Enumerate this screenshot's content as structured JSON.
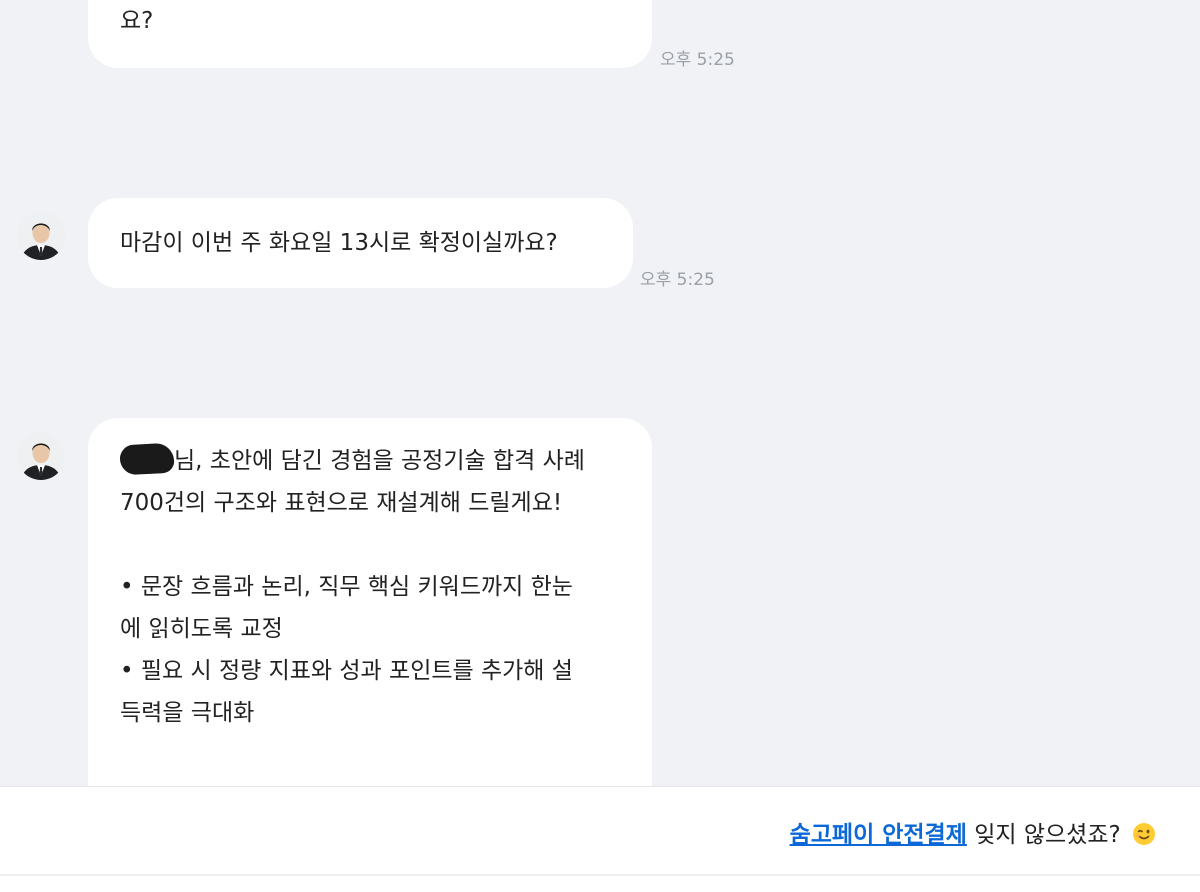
{
  "messages": [
    {
      "lines": [
        "요?"
      ],
      "time": "오후 5:25"
    },
    {
      "lines": [
        "마감이 이번 주 화요일 13시로 확정이실까요?"
      ],
      "time": "오후 5:25"
    },
    {
      "first_line_suffix": "님, 초안에 담긴 경험을 공정기술 합격 사례",
      "lines": [
        "700건의 구조와 표현으로 재설계해 드릴게요!",
        "",
        "• 문장 흐름과 논리, 직무 핵심 키워드까지 한눈",
        "에 읽히도록 교정",
        "• 필요 시 정량 지표와 성과 포인트를 추가해 설",
        "득력을 극대화"
      ]
    }
  ],
  "footer": {
    "link_text": "숨고페이 안전결제",
    "rest_text": " 잊지 않으셨죠? ",
    "emoji_icon": "wink-emoji-icon"
  },
  "colors": {
    "background": "#f1f2f5",
    "bubble": "#ffffff",
    "link": "#0b68d6",
    "timestamp": "#9aa0a8"
  }
}
